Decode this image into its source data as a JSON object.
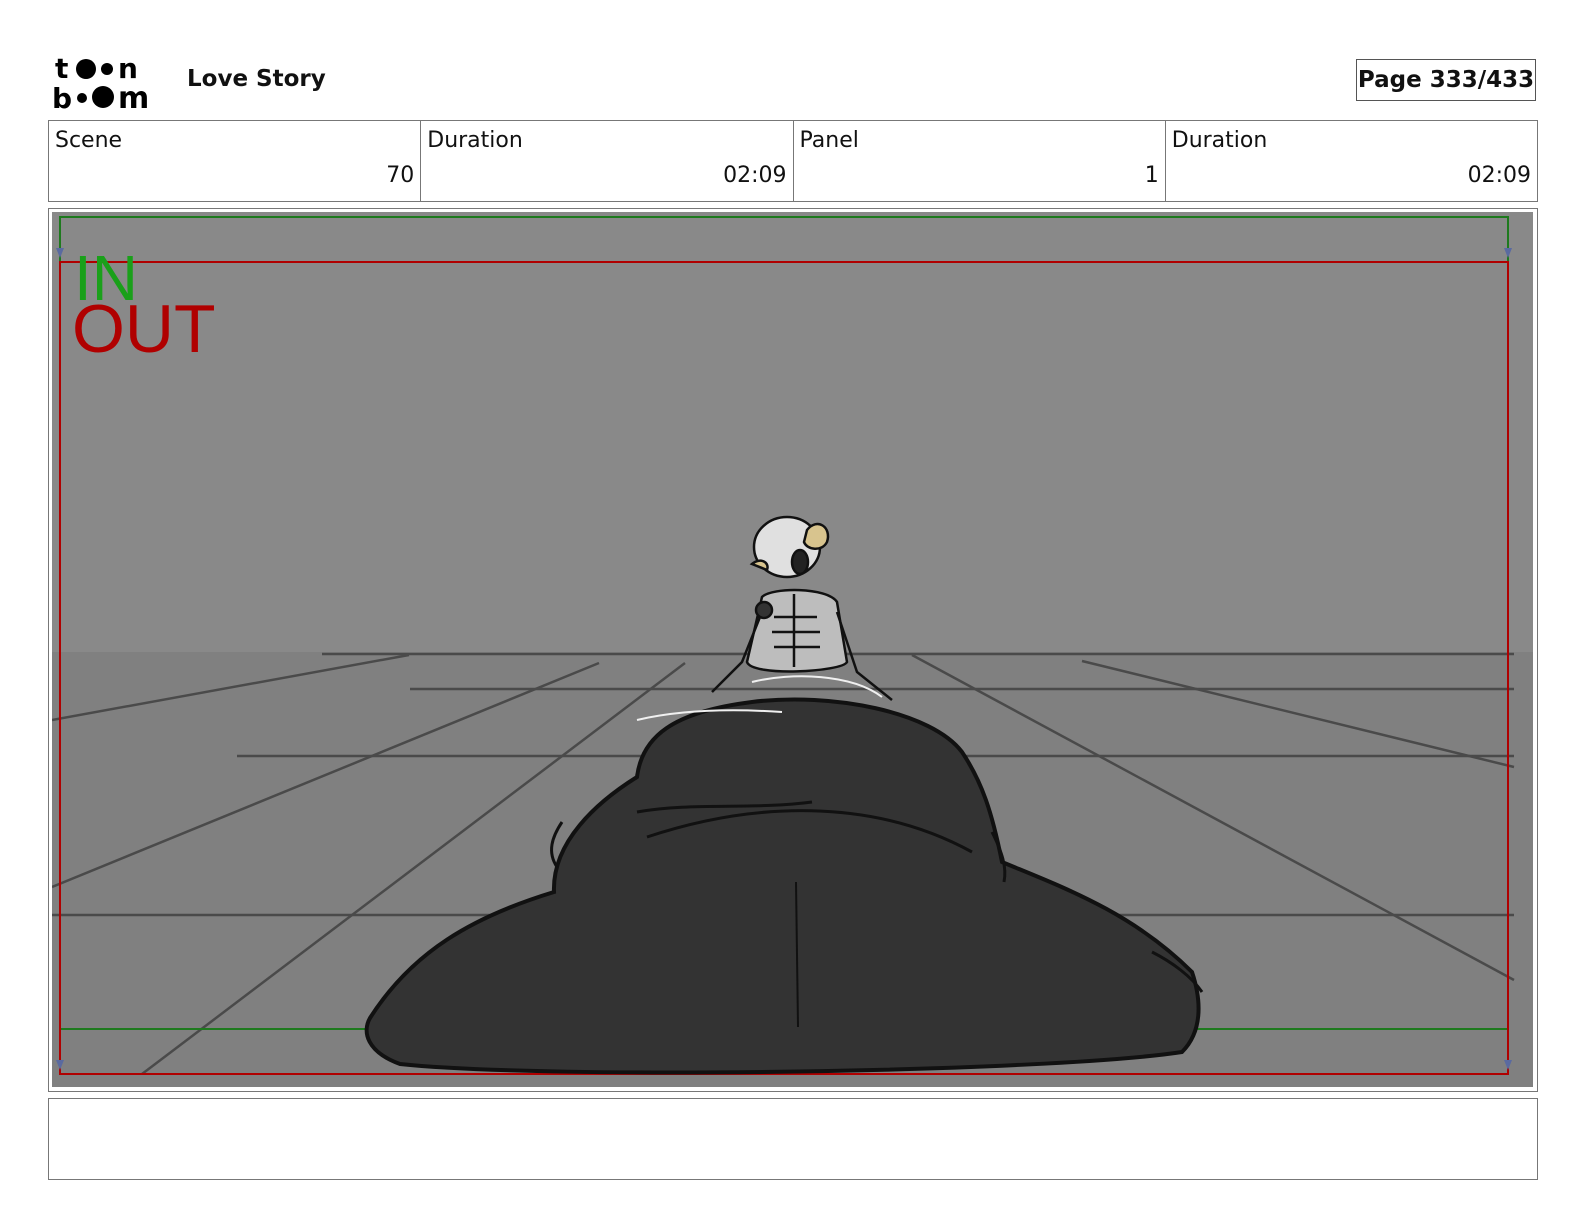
{
  "header": {
    "logo_text": "toon boom",
    "project_title": "Love Story",
    "page_label": "Page 333/433"
  },
  "info": [
    {
      "label": "Scene",
      "value": "70"
    },
    {
      "label": "Duration",
      "value": "02:09"
    },
    {
      "label": "Panel",
      "value": "1"
    },
    {
      "label": "Duration",
      "value": "02:09"
    }
  ],
  "panel": {
    "in_label": "IN",
    "out_label": "OUT",
    "colors": {
      "sky": "#898989",
      "floor": "#7f7f7f",
      "in_frame": "#1e7a1e",
      "out_frame": "#b00000",
      "figure": "#333333"
    }
  },
  "notes": ""
}
